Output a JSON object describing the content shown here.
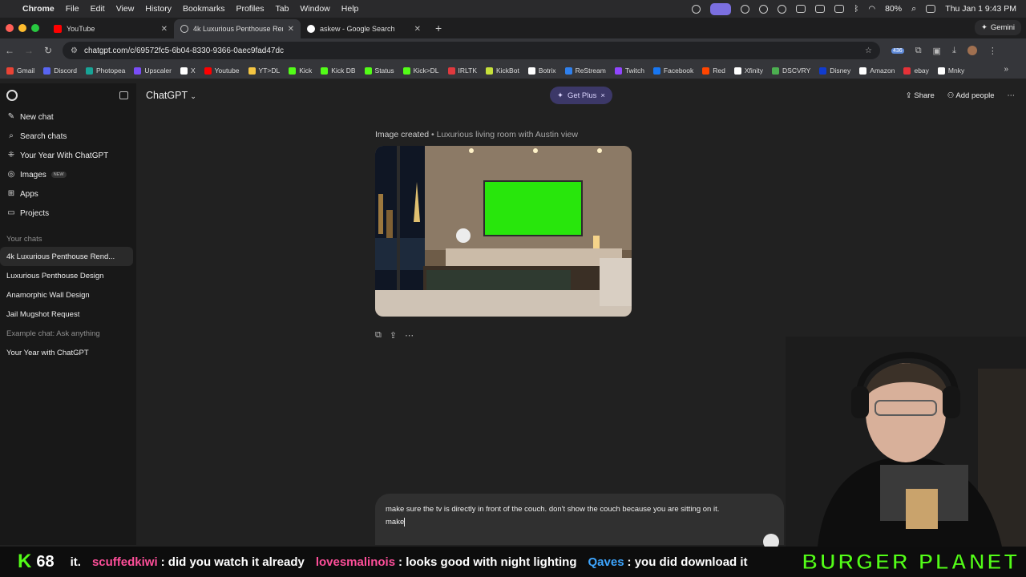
{
  "menubar": {
    "app": "Chrome",
    "items": [
      "File",
      "Edit",
      "View",
      "History",
      "Bookmarks",
      "Profiles",
      "Tab",
      "Window",
      "Help"
    ],
    "battery": "80%",
    "clock": "Thu Jan 1  9:43 PM"
  },
  "tabs": [
    {
      "title": "YouTube",
      "favicon_color": "#ff0000"
    },
    {
      "title": "4k Luxurious Penthouse Ren…",
      "favicon_color": "#cccccc"
    },
    {
      "title": "askew - Google Search",
      "favicon_color": "#4285f4"
    }
  ],
  "gemini_label": "Gemini",
  "address": {
    "url": "chatgpt.com/c/69572fc5-6b04-8330-9366-0aec9fad47dc",
    "extension_badge": "436"
  },
  "bookmarks": [
    {
      "label": "Gmail",
      "color": "#ea4335"
    },
    {
      "label": "Discord",
      "color": "#5865f2"
    },
    {
      "label": "Photopea",
      "color": "#18a497"
    },
    {
      "label": "Upscaler",
      "color": "#7a4df7"
    },
    {
      "label": "X",
      "color": "#ffffff"
    },
    {
      "label": "Youtube",
      "color": "#ff0000"
    },
    {
      "label": "YT>DL",
      "color": "#f4c542"
    },
    {
      "label": "Kick",
      "color": "#53fc18"
    },
    {
      "label": "Kick DB",
      "color": "#53fc18"
    },
    {
      "label": "Status",
      "color": "#53fc18"
    },
    {
      "label": "Kick>DL",
      "color": "#53fc18"
    },
    {
      "label": "IRLTK",
      "color": "#e0393e"
    },
    {
      "label": "KickBot",
      "color": "#c6e03a"
    },
    {
      "label": "Botrix",
      "color": "#ffffff"
    },
    {
      "label": "ReStream",
      "color": "#2f80ed"
    },
    {
      "label": "Twitch",
      "color": "#9146ff"
    },
    {
      "label": "Facebook",
      "color": "#1877f2"
    },
    {
      "label": "Red",
      "color": "#ff4500"
    },
    {
      "label": "Xfinity",
      "color": "#ffffff"
    },
    {
      "label": "DSCVRY",
      "color": "#4caf50"
    },
    {
      "label": "Disney",
      "color": "#113ccf"
    },
    {
      "label": "Amazon",
      "color": "#ffffff"
    },
    {
      "label": "ebay",
      "color": "#e53238"
    },
    {
      "label": "Mnky",
      "color": "#ffffff"
    }
  ],
  "sidebar": {
    "nav": [
      {
        "label": "New chat",
        "icon": "pencil-icon",
        "glyph": "✎"
      },
      {
        "label": "Search chats",
        "icon": "search-icon",
        "glyph": "⌕"
      },
      {
        "label": "Your Year With ChatGPT",
        "icon": "sparkle-icon",
        "glyph": "⁜"
      },
      {
        "label": "Images",
        "icon": "images-icon",
        "glyph": "◎",
        "tag": "NEW"
      },
      {
        "label": "Apps",
        "icon": "apps-icon",
        "glyph": "⊞"
      },
      {
        "label": "Projects",
        "icon": "folder-icon",
        "glyph": "▭"
      }
    ],
    "chats_heading": "Your chats",
    "chats": [
      {
        "label": "4k Luxurious Penthouse Rend...",
        "active": true
      },
      {
        "label": "Luxurious Penthouse Design"
      },
      {
        "label": "Anamorphic Wall Design"
      },
      {
        "label": "Jail Mugshot Request"
      },
      {
        "label": "Example chat: Ask anything",
        "muted": true
      },
      {
        "label": "Your Year with ChatGPT"
      }
    ]
  },
  "header": {
    "model": "ChatGPT",
    "get_plus": "Get Plus",
    "share": "Share",
    "add_people": "Add people"
  },
  "message": {
    "caption_title": "Image created",
    "caption_sub": "Luxurious living room with Austin view"
  },
  "composer": {
    "line1": "make sure the tv is directly in front of the couch. don't show the couch because you are sitting on it.",
    "line2": "make"
  },
  "ticker": {
    "viewer_count": "68",
    "segments": [
      {
        "user": "",
        "text": "it."
      },
      {
        "user": "scuffedkiwi",
        "user_color": "#ff4f9a",
        "text": ": did you watch it already"
      },
      {
        "user": "lovesmalinois",
        "user_color": "#ff4f9a",
        "text": ": looks good with night lighting"
      },
      {
        "user": "Qaves",
        "user_color": "#3ea6ff",
        "text": ": you did download it"
      }
    ],
    "brand": "BURGER PLANET"
  }
}
